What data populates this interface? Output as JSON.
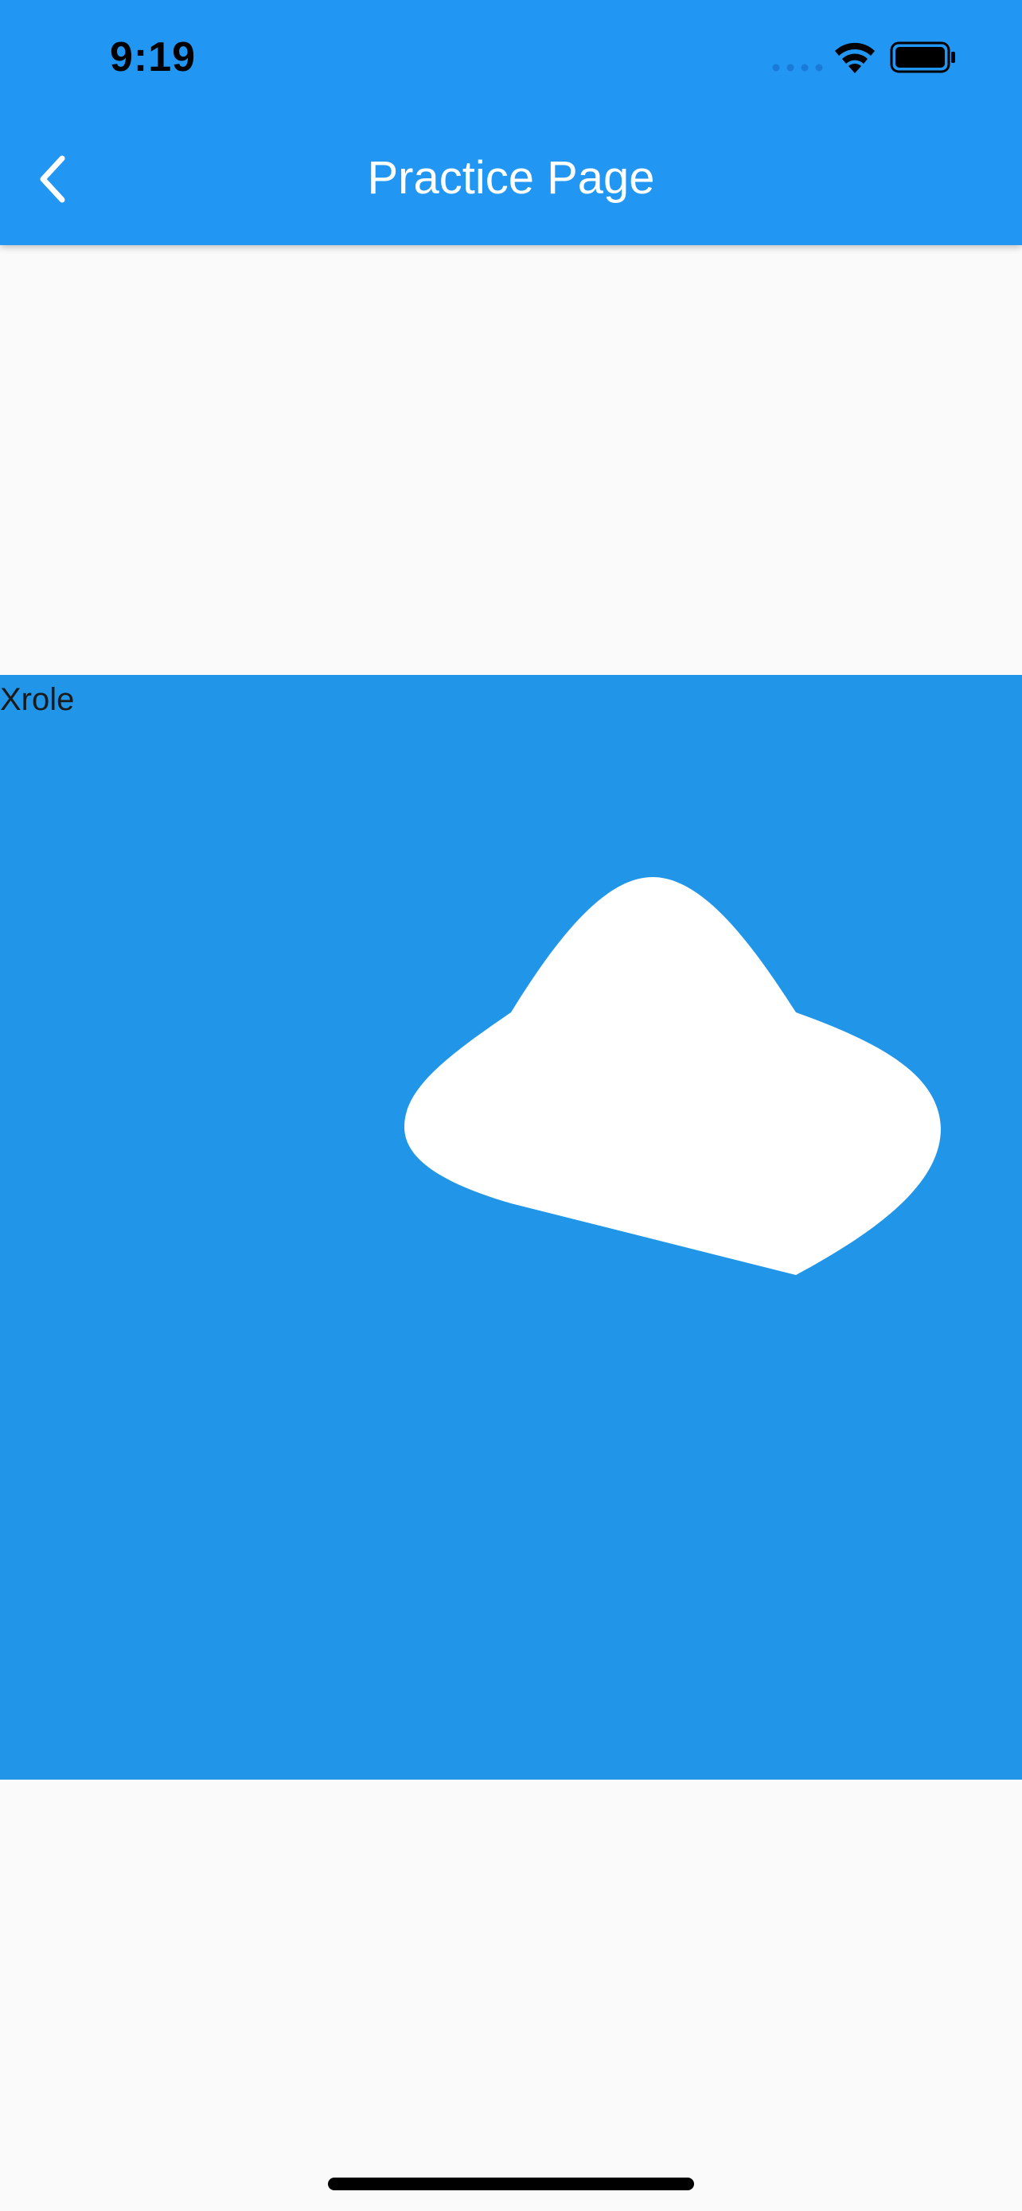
{
  "status_bar": {
    "time": "9:19",
    "signal_icon": "signal-dots-icon",
    "wifi_icon": "wifi-icon",
    "battery_icon": "battery-full-icon"
  },
  "app_bar": {
    "title": "Practice Page",
    "back_icon": "chevron-left-icon",
    "color": "#2196f3"
  },
  "panel": {
    "label": "Xrole",
    "color": "#2196e8",
    "shape_color": "#ffffff"
  },
  "colors": {
    "background": "#fafafa",
    "title_text": "#ffffff"
  }
}
